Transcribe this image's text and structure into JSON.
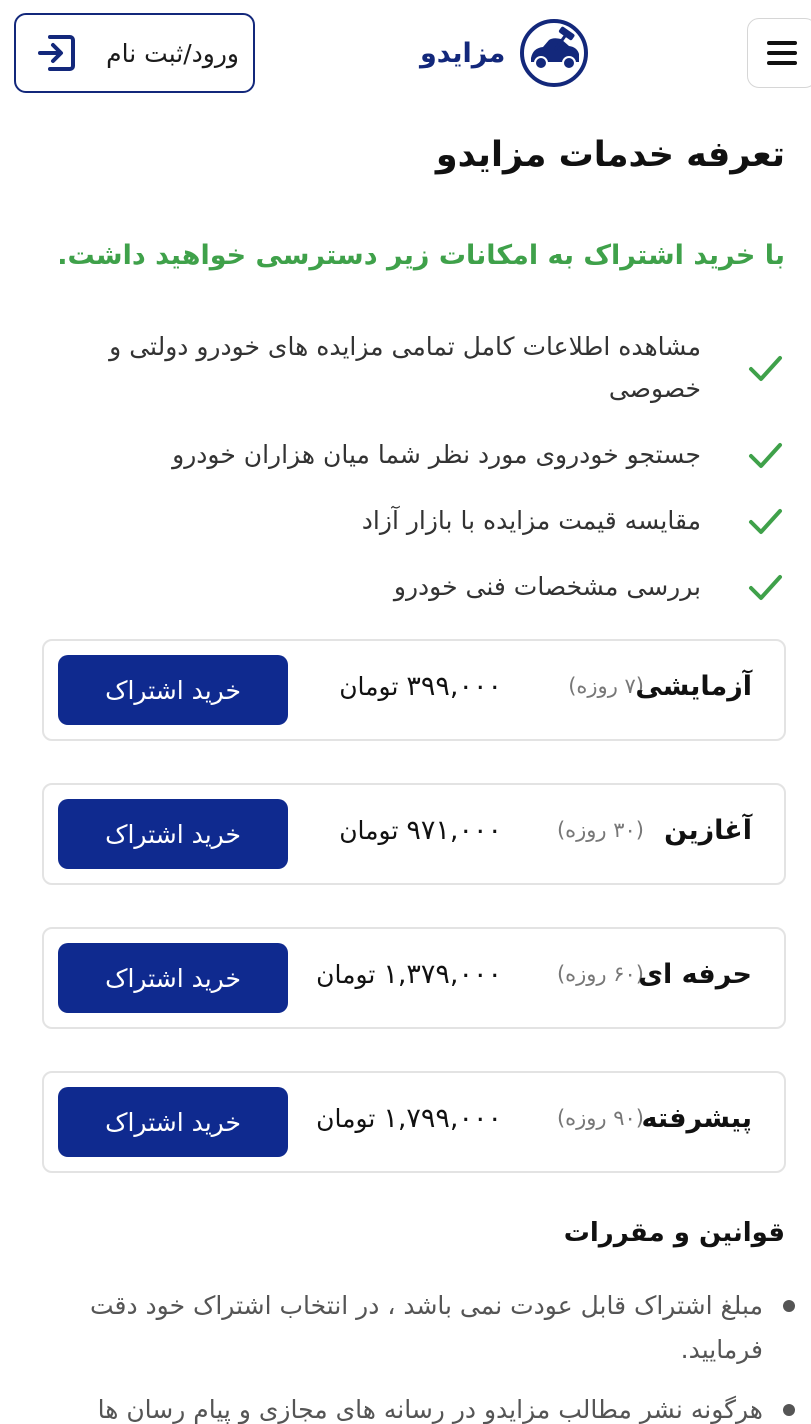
{
  "header": {
    "login_label": "ورود/ثبت نام",
    "logo_text": "مزایدو",
    "menu_icon": "hamburger-menu-icon",
    "login_icon": "login-arrow-icon"
  },
  "page_title": "تعرفه خدمات مزایدو",
  "subtitle": "با خرید اشتراک به امکانات زیر دسترسی خواهید داشت.",
  "features": [
    "مشاهده اطلاعات کامل تمامی مزایده های خودرو دولتی و خصوصی",
    "جستجو خودروی مورد نظر شما میان هزاران خودرو",
    "مقایسه قیمت مزایده با بازار آزاد",
    "بررسی مشخصات فنی خودرو"
  ],
  "plans": [
    {
      "name": "آزمایشی",
      "duration": "(۷ روزه)",
      "price": "۳۹۹,۰۰۰",
      "currency": "تومان",
      "button": "خرید اشتراک"
    },
    {
      "name": "آغازین",
      "duration": "(۳۰ روزه)",
      "price": "۹۷۱,۰۰۰",
      "currency": "تومان",
      "button": "خرید اشتراک"
    },
    {
      "name": "حرفه ای",
      "duration": "(۶۰ روزه)",
      "price": "۱,۳۷۹,۰۰۰",
      "currency": "تومان",
      "button": "خرید اشتراک"
    },
    {
      "name": "پیشرفته",
      "duration": "(۹۰ روزه)",
      "price": "۱,۷۹۹,۰۰۰",
      "currency": "تومان",
      "button": "خرید اشتراک"
    }
  ],
  "rules_title": "قوانین و مقررات",
  "rules": [
    "مبلغ اشتراک قابل عودت نمی باشد ، در انتخاب اشتراک خود دقت فرمایید.",
    "هرگونه نشر مطالب مزایدو در رسانه های مجازی و پیام رسان ها"
  ],
  "colors": {
    "brand_navy": "#13287b",
    "button_blue": "#0f2a8f",
    "accent_green": "#3fa14a"
  }
}
